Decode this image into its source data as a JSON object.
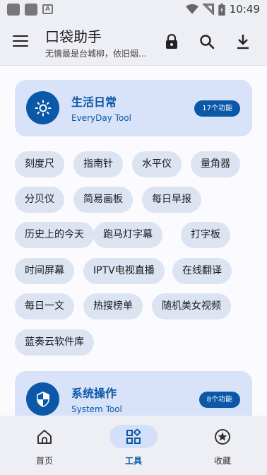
{
  "status_bar": {
    "time": "10:49",
    "notification_icons": [
      "square-icon",
      "square-icon",
      "a-icon"
    ]
  },
  "app_bar": {
    "title": "口袋助手",
    "subtitle": "无情最是台城柳，依旧烟...",
    "icons": [
      "menu-icon",
      "lock-icon",
      "search-icon",
      "download-icon"
    ]
  },
  "categories": [
    {
      "title": "生活日常",
      "subtitle": "EveryDay Tool",
      "badge": "17个功能",
      "icon": "sun-icon",
      "tools": [
        "刻度尺",
        "指南针",
        "水平仪",
        "量角器",
        "分贝仪",
        "简易画板",
        "每日早报",
        "历史上的今天",
        "跑马灯字幕",
        "打字板",
        "时间屏幕",
        "IPTV电视直播",
        "在线翻译",
        "每日一文",
        "热搜榜单",
        "随机美女视频",
        "蓝奏云软件库"
      ]
    },
    {
      "title": "系统操作",
      "subtitle": "System Tool",
      "badge": "8个功能",
      "icon": "shield-icon"
    }
  ],
  "bottom_nav": [
    {
      "label": "首页",
      "icon": "home-icon",
      "active": false
    },
    {
      "label": "工具",
      "icon": "tools-icon",
      "active": true
    },
    {
      "label": "收藏",
      "icon": "star-icon",
      "active": false
    }
  ],
  "colors": {
    "accent": "#0b58a8",
    "card_bg": "#d8e2f9",
    "chip_bg": "#dce3f1",
    "bar_bg": "#eeeff4"
  }
}
